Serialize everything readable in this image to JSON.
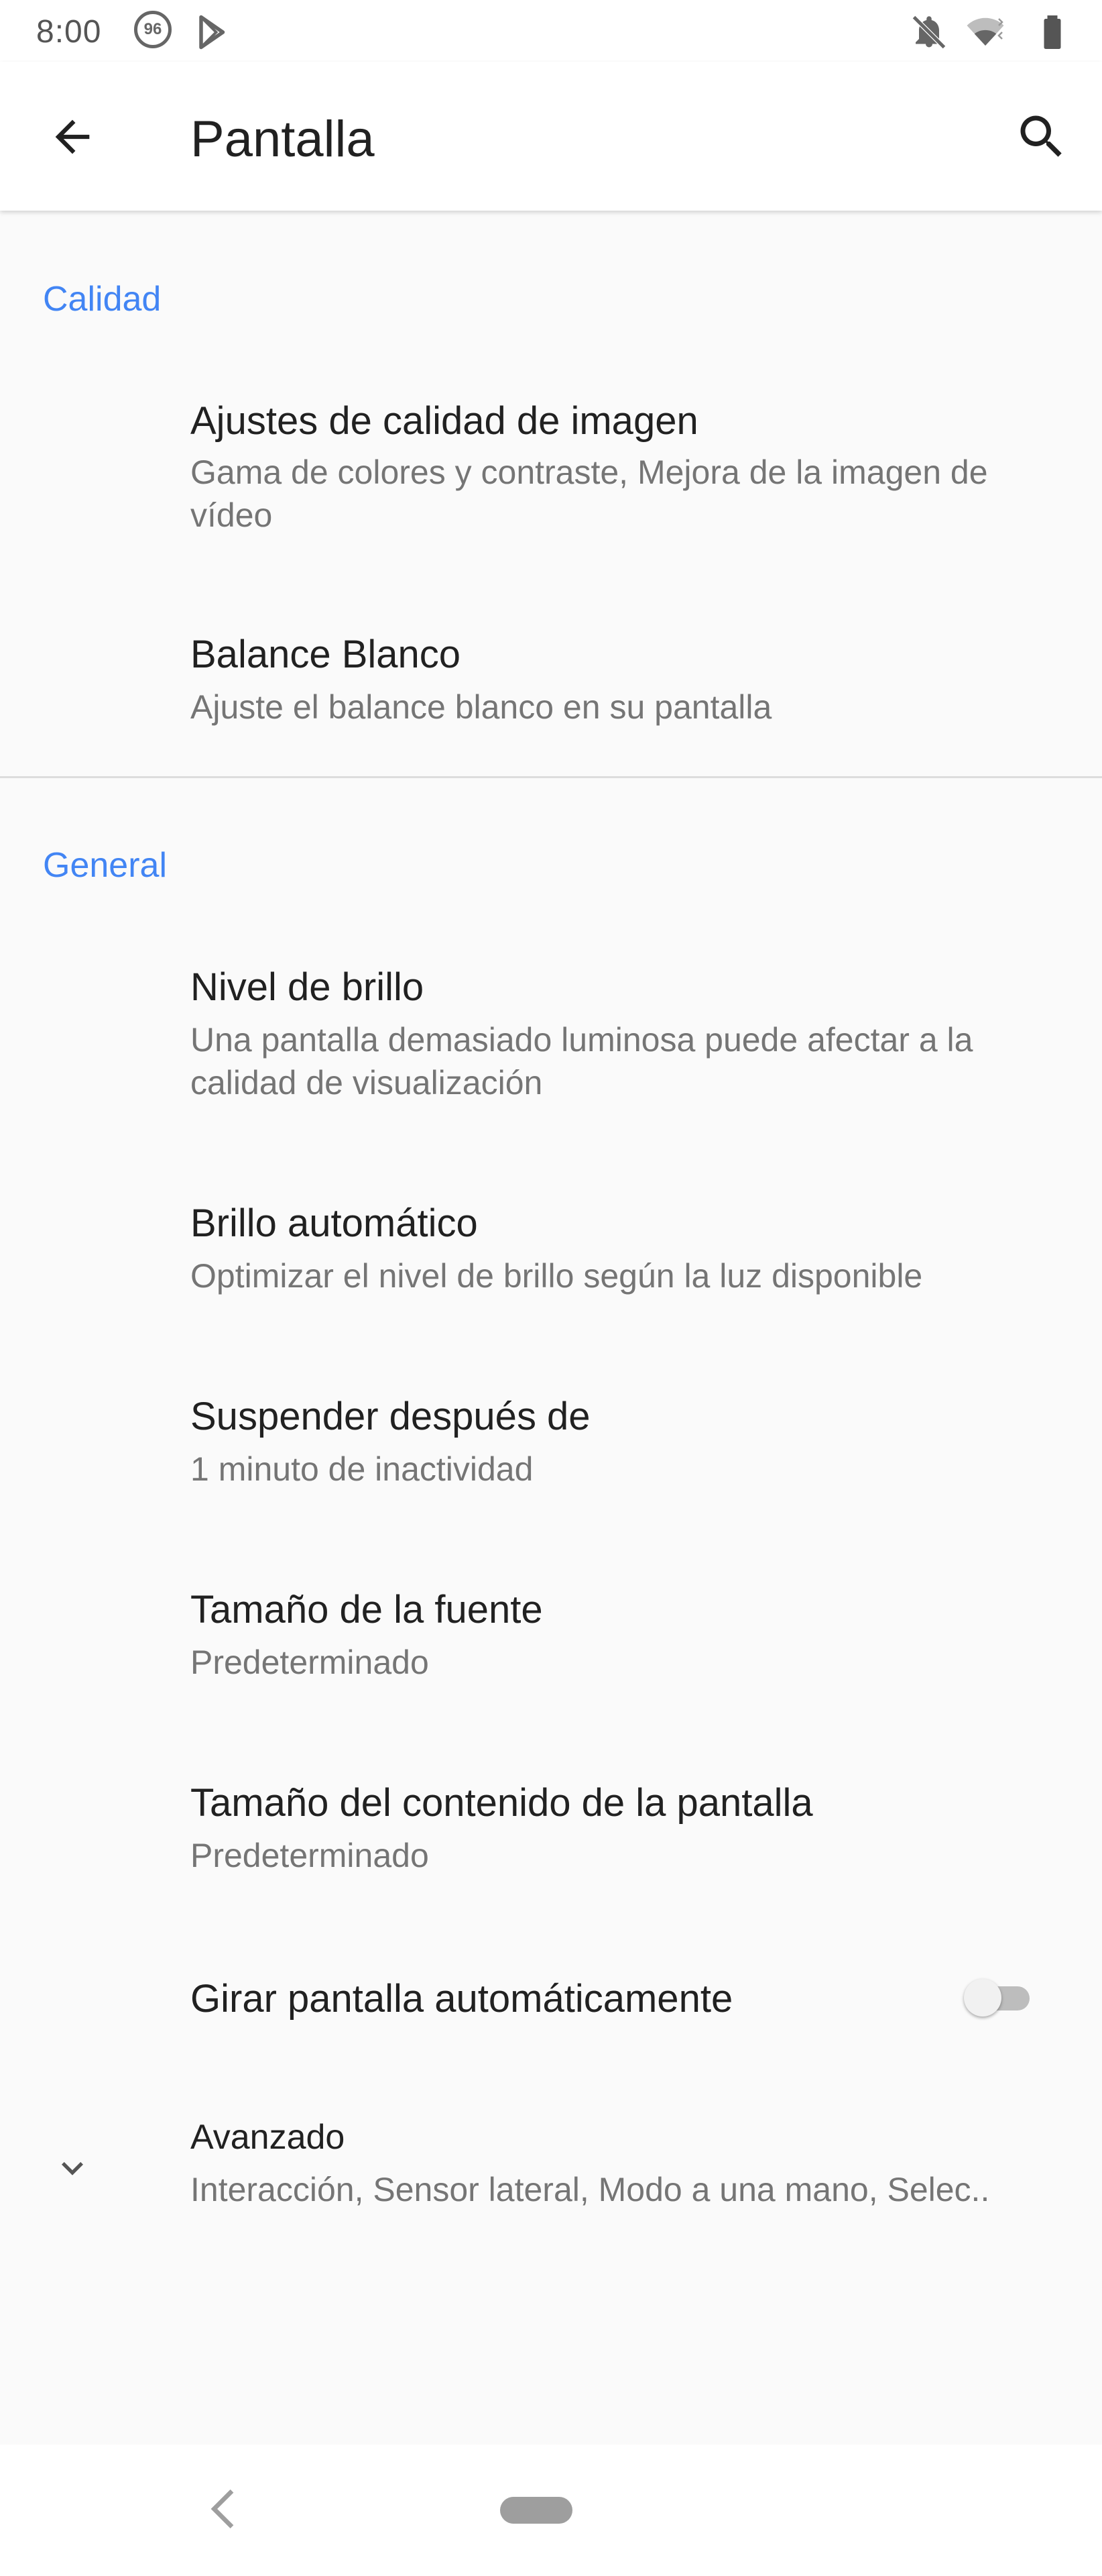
{
  "status_bar": {
    "time": "8:00",
    "badge": "96",
    "icons": [
      "data-saver-badge-icon",
      "play-store-icon",
      "notifications-off-icon",
      "wifi-icon",
      "battery-icon"
    ]
  },
  "app_bar": {
    "title": "Pantalla",
    "back_icon": "arrow-back-icon",
    "search_icon": "search-icon"
  },
  "sections": {
    "quality": {
      "header": "Calidad",
      "items": [
        {
          "title": "Ajustes de calidad de imagen",
          "summary": "Gama de colores y contraste, Mejora de la imagen de vídeo"
        },
        {
          "title": "Balance Blanco",
          "summary": "Ajuste el balance blanco en su pantalla"
        }
      ]
    },
    "general": {
      "header": "General",
      "items": [
        {
          "title": "Nivel de brillo",
          "summary": "Una pantalla demasiado luminosa puede afectar a la calidad de visualización"
        },
        {
          "title": "Brillo automático",
          "summary": "Optimizar el nivel de brillo según la luz disponible"
        },
        {
          "title": "Suspender después de",
          "summary": "1 minuto de inactividad"
        },
        {
          "title": "Tamaño de la fuente",
          "summary": "Predeterminado"
        },
        {
          "title": "Tamaño del contenido de la pantalla",
          "summary": "Predeterminado"
        },
        {
          "title": "Girar pantalla automáticamente",
          "toggle_on": false
        },
        {
          "title": "Avanzado",
          "summary": "Interacción, Sensor lateral, Modo a una mano, Selec..",
          "icon": "chevron-down-icon"
        }
      ]
    }
  },
  "colors": {
    "accent": "#4285f4",
    "background": "#fafafa",
    "title_text": "#212121",
    "summary_text": "#757575"
  },
  "nav_bar": {
    "back_icon": "nav-back-icon",
    "home_icon": "nav-home-pill-icon"
  }
}
